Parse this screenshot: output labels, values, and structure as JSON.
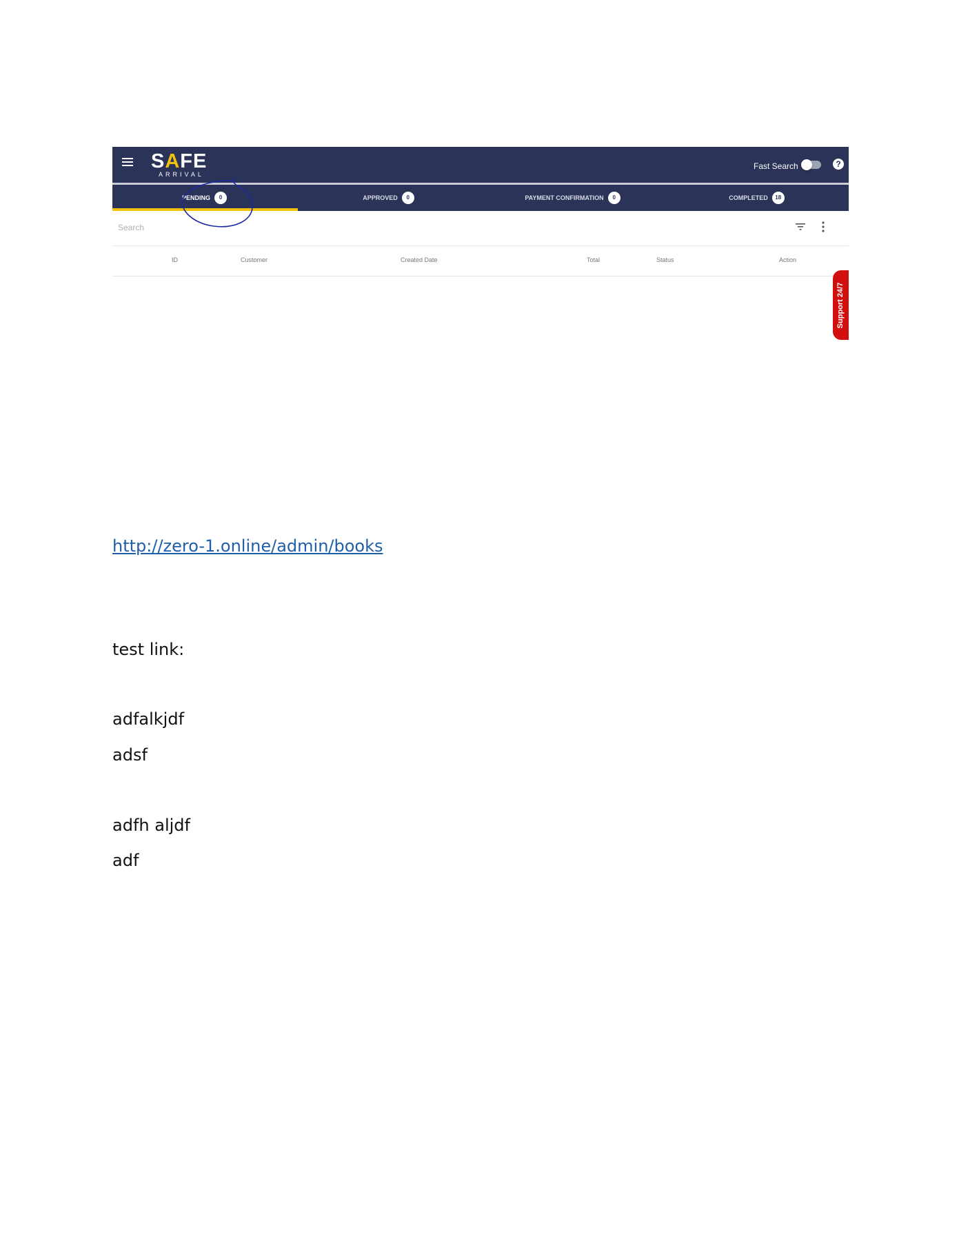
{
  "app": {
    "logo": {
      "safe_prefix": "S",
      "safe_a": "A",
      "safe_suffix": "FE",
      "arrival": "ARRIVAL"
    },
    "header": {
      "fast_search_label": "Fast Search",
      "help_glyph": "?"
    },
    "tabs": [
      {
        "label": "PENDING",
        "count": "0",
        "active": true
      },
      {
        "label": "APPROVED",
        "count": "0",
        "active": false
      },
      {
        "label": "PAYMENT CONFIRMATION",
        "count": "0",
        "active": false
      },
      {
        "label": "COMPLETED",
        "count": "18",
        "active": false
      }
    ],
    "search": {
      "placeholder": "Search",
      "value": ""
    },
    "table": {
      "columns": [
        "ID",
        "Customer",
        "Created Date",
        "Total",
        "Status",
        "Action"
      ],
      "rows": []
    },
    "support_tab": "Support 24/7",
    "colors": {
      "header_bg": "#2b3358",
      "accent_yellow": "#f2c10f",
      "support_red": "#d10f0f",
      "annotation_blue": "#1c2a9e"
    },
    "icons": [
      "hamburger-menu-icon",
      "toggle-switch",
      "help-icon",
      "filter-icon",
      "more-vert-icon"
    ]
  },
  "document": {
    "link": "http://zero-1.online/admin/books",
    "lines": [
      "test link:",
      "adfalkjdf",
      "adsf",
      "adfh aljdf",
      "adf"
    ]
  }
}
